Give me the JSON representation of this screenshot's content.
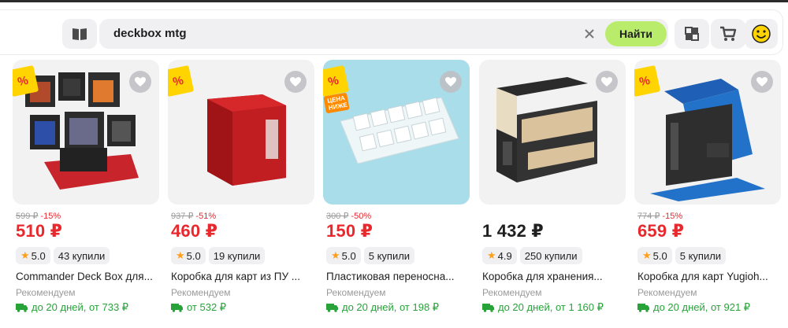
{
  "header": {
    "search_value": "deckbox mtg",
    "find_label": "Найти"
  },
  "colors": {
    "accent_green": "#b9ec6a",
    "price_red": "#e9282d",
    "delivery_green": "#27a33a",
    "sale_yellow": "#ffd400"
  },
  "products": [
    {
      "old_price": "599 ₽",
      "discount": "-15%",
      "price": "510 ₽",
      "rating": "5.0",
      "bought": "43 купили",
      "title": "Commander Deck Box для...",
      "recommend": "Рекомендуем",
      "delivery": "до 20 дней, от 733 ₽",
      "sale_badge": "%",
      "low_price_badge": ""
    },
    {
      "old_price": "937 ₽",
      "discount": "-51%",
      "price": "460 ₽",
      "rating": "5.0",
      "bought": "19 купили",
      "title": "Коробка для карт из ПУ ...",
      "recommend": "Рекомендуем",
      "delivery": "от 532 ₽",
      "sale_badge": "%",
      "low_price_badge": ""
    },
    {
      "old_price": "300 ₽",
      "discount": "-50%",
      "price": "150 ₽",
      "rating": "5.0",
      "bought": "5 купили",
      "title": "Пластиковая переносна...",
      "recommend": "Рекомендуем",
      "delivery": "до 20 дней, от 198 ₽",
      "sale_badge": "%",
      "low_price_badge": "ЦЕНА НИЖЕ"
    },
    {
      "old_price": "",
      "discount": "",
      "price": "1 432 ₽",
      "rating": "4.9",
      "bought": "250 купили",
      "title": "Коробка для хранения...",
      "recommend": "Рекомендуем",
      "delivery": "до 20 дней, от 1 160 ₽",
      "sale_badge": "",
      "low_price_badge": ""
    },
    {
      "old_price": "774 ₽",
      "discount": "-15%",
      "price": "659 ₽",
      "rating": "5.0",
      "bought": "5 купили",
      "title": "Коробка для карт Yugioh...",
      "recommend": "Рекомендуем",
      "delivery": "до 20 дней, от 921 ₽",
      "sale_badge": "%",
      "low_price_badge": ""
    }
  ]
}
